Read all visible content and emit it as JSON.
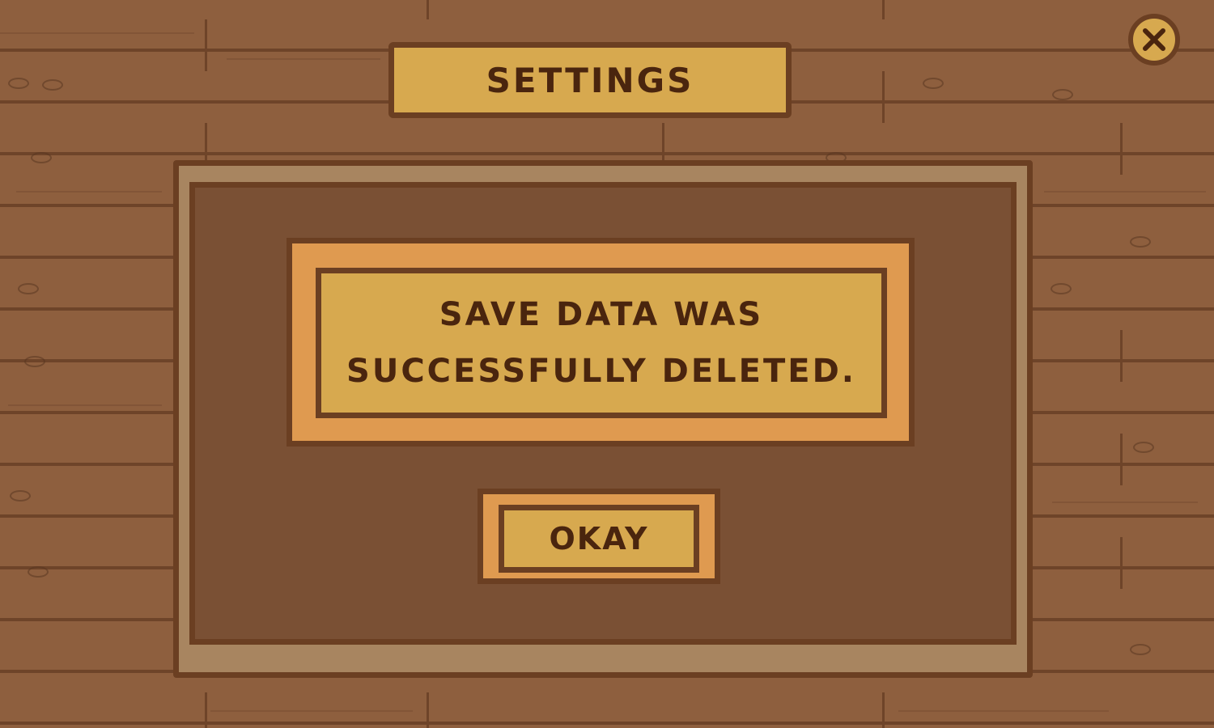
{
  "screen": {
    "title": "SETTINGS",
    "close_icon": "close-icon"
  },
  "dialog": {
    "message_line_1": "SAVE DATA WAS",
    "message_line_2": "SUCCESSFULLY DELETED.",
    "okay_label": "OKAY"
  },
  "colors": {
    "wood": "#8e5f3e",
    "outline": "#6b3f22",
    "gold": "#d7a94f",
    "orange": "#df9a50",
    "panel_dark": "#7a5034",
    "panel_border": "#a88560",
    "text": "#4a250e"
  }
}
